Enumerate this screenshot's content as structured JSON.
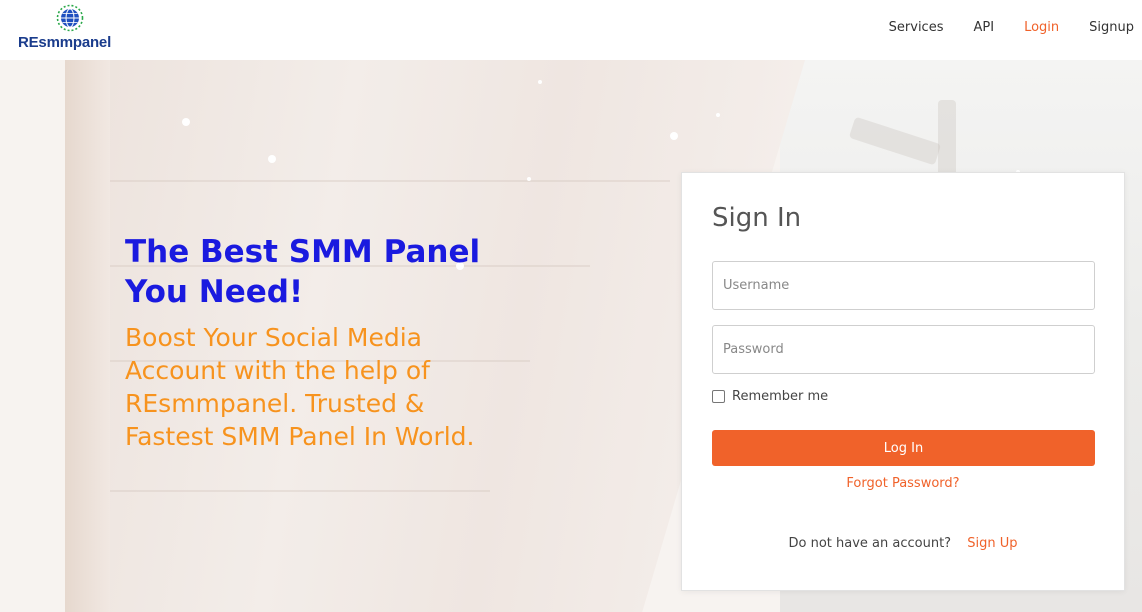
{
  "brand": {
    "name": "REsmmpanel",
    "color": "#1a3c8c"
  },
  "nav": {
    "items": [
      {
        "label": "Services"
      },
      {
        "label": "API"
      },
      {
        "label": "Login",
        "active": true
      },
      {
        "label": "Signup"
      }
    ],
    "active_color": "#f0622a"
  },
  "hero": {
    "title": "The Best SMM Panel You Need!",
    "subtitle": "Boost Your Social Media Account with the help of REsmmpanel. Trusted & Fastest SMM Panel In World.",
    "title_color": "#1a1adf",
    "subtitle_color": "#f7931e"
  },
  "login": {
    "title": "Sign In",
    "username_placeholder": "Username",
    "password_placeholder": "Password",
    "remember_label": "Remember me",
    "remember_checked": false,
    "submit_label": "Log In",
    "forgot_label": "Forgot Password?",
    "no_account_text": "Do not have an account?",
    "signup_label": "Sign Up",
    "accent_color": "#f0622a"
  },
  "icons": {
    "logo": "globe-icon",
    "remember": "checkbox"
  }
}
